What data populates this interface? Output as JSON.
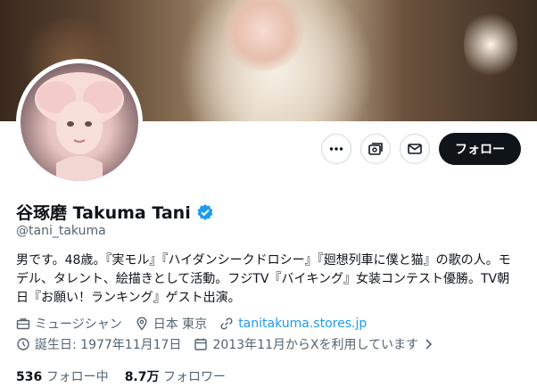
{
  "profile": {
    "display_name": "谷琢磨 Takuma Tani",
    "handle": "@tani_takuma",
    "bio": "男です。48歳。『実モル』『ハイダンシークドロシー』『廻想列車に僕と猫』の歌の人。モデル、タレント、絵描きとして活動。フジTV『バイキング』女装コンテスト優勝。TV朝日『お願い！ランキング』ゲスト出演。",
    "category": "ミュージシャン",
    "location": "日本 東京",
    "website": "tanitakuma.stores.jp",
    "birthday": "誕生日: 1977年11月17日",
    "joined": "2013年11月からXを利用しています"
  },
  "actions": {
    "follow_label": "フォロー"
  },
  "stats": {
    "following_count": "536",
    "following_label": "フォロー中",
    "followers_count": "8.7万",
    "followers_label": "フォロワー"
  },
  "colors": {
    "accent": "#1d9bf0",
    "verified": "#1d9bf0",
    "text_primary": "#0f1419",
    "text_secondary": "#536471"
  },
  "icons": [
    "more-icon",
    "subscribe-icon",
    "message-icon",
    "verified-badge-icon",
    "briefcase-icon",
    "location-icon",
    "link-icon",
    "birthday-icon",
    "calendar-icon",
    "chevron-right-icon"
  ]
}
